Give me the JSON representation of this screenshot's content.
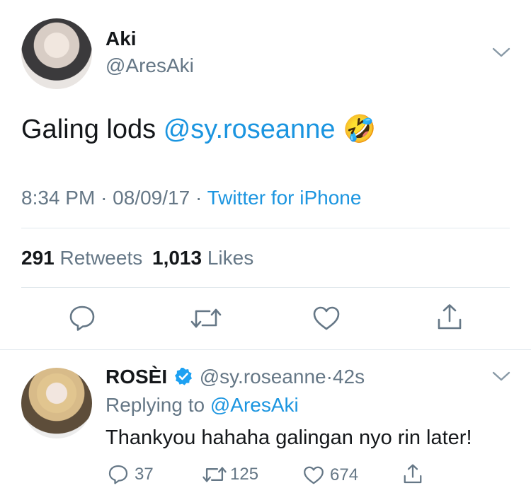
{
  "tweet": {
    "author_name": "Aki",
    "author_handle": "@AresAki",
    "text_main": "Galing lods",
    "text_mention": "@sy.roseanne",
    "emoji": "🤣",
    "time": "8:34 PM",
    "dot1": "·",
    "date": "08/09/17",
    "dot2": "·",
    "source": "Twitter for iPhone",
    "retweets_count": "291",
    "retweets_label": "Retweets",
    "likes_count": "1,013",
    "likes_label": "Likes"
  },
  "reply": {
    "author_name": "ROSÈI",
    "author_handle": "@sy.roseanne",
    "dot": "·",
    "time_ago": "42s",
    "replying_label": "Replying to",
    "replying_handle": "@AresAki",
    "text": "Thankyou hahaha galingan nyo rin later!",
    "reply_count": "37",
    "retweet_count": "125",
    "like_count": "674"
  },
  "colors": {
    "link_blue": "#1b95e0",
    "secondary_grey": "#657786",
    "divider": "#e1e8ed",
    "verified_blue": "#1da1f2"
  },
  "icons": [
    "chevron-down-icon",
    "reply-icon",
    "retweet-icon",
    "like-icon",
    "share-icon",
    "verified-badge-icon"
  ]
}
